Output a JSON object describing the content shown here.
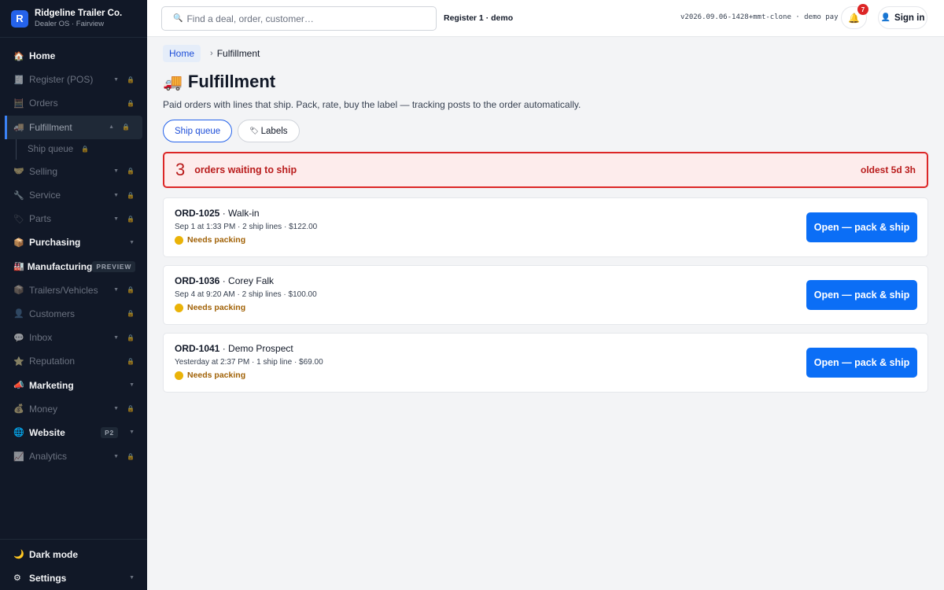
{
  "brand": {
    "initial": "R",
    "name": "Ridgeline Trailer Co.",
    "sub": "Dealer OS · Fairview"
  },
  "nav": {
    "home": "Home",
    "register": "Register (POS)",
    "orders": "Orders",
    "fulfillment": "Fulfillment",
    "ship_queue": "Ship queue",
    "selling": "Selling",
    "service": "Service",
    "parts": "Parts",
    "purchasing": "Purchasing",
    "manufacturing": "Manufacturing",
    "manufacturing_tag": "PREVIEW",
    "trailers": "Trailers/Vehicles",
    "customers": "Customers",
    "inbox": "Inbox",
    "reputation": "Reputation",
    "marketing": "Marketing",
    "money": "Money",
    "website": "Website",
    "website_tag": "P2",
    "analytics": "Analytics",
    "dark_mode": "Dark mode",
    "settings": "Settings"
  },
  "topbar": {
    "search_placeholder": "Find a deal, order, customer…",
    "register": "Register 1 · demo",
    "version": "v2026.09.06-1428+mmt-clone · demo pay",
    "notifications": "7",
    "sign_in": "Sign in"
  },
  "breadcrumb": {
    "home": "Home",
    "sep": "›",
    "current": "Fulfillment"
  },
  "page": {
    "title": "Fulfillment",
    "subtitle": "Paid orders with lines that ship. Pack, rate, buy the label — tracking posts to the order automatically."
  },
  "tabs": {
    "ship_queue": "Ship queue",
    "labels": "Labels"
  },
  "alert": {
    "count": "3",
    "text": "orders waiting to ship",
    "oldest": "oldest 5d 3h"
  },
  "orders": [
    {
      "id": "ORD-1025",
      "customer": "· Walk-in",
      "meta": "Sep 1 at 1:33 PM · 2 ship lines · $122.00",
      "status": "Needs packing",
      "action": "Open — pack & ship"
    },
    {
      "id": "ORD-1036",
      "customer": "· Corey Falk",
      "meta": "Sep 4 at 9:20 AM · 2 ship lines · $100.00",
      "status": "Needs packing",
      "action": "Open — pack & ship"
    },
    {
      "id": "ORD-1041",
      "customer": "· Demo Prospect",
      "meta": "Yesterday at 2:37 PM · 1 ship line · $69.00",
      "status": "Needs packing",
      "action": "Open — pack & ship"
    }
  ],
  "colors": {
    "accent": "#0b6ef6",
    "alert": "#dc2626",
    "sidebar": "#111827",
    "status": "#a16207"
  }
}
